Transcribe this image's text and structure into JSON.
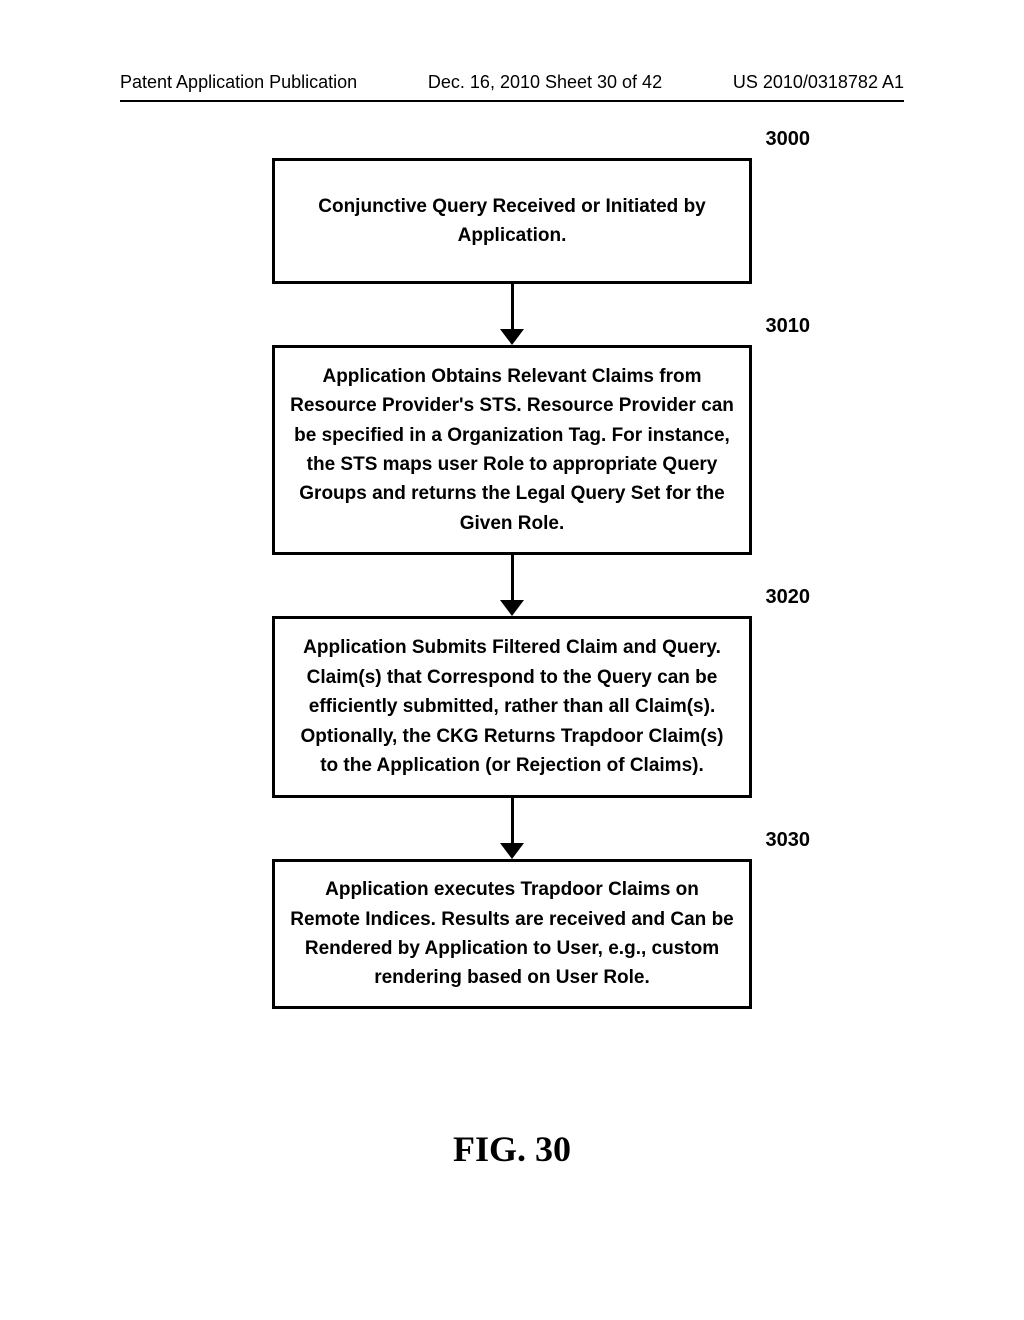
{
  "header": {
    "left": "Patent Application Publication",
    "center": "Dec. 16, 2010  Sheet 30 of 42",
    "right": "US 2010/0318782 A1"
  },
  "steps": [
    {
      "ref": "3000",
      "text": "Conjunctive Query Received or Initiated by Application."
    },
    {
      "ref": "3010",
      "text": "Application Obtains Relevant Claims from Resource Provider's STS. Resource Provider can be specified in a Organization Tag. For instance, the STS maps user Role to appropriate Query Groups and returns the Legal Query Set for the Given Role."
    },
    {
      "ref": "3020",
      "text": "Application Submits Filtered Claim and Query. Claim(s) that Correspond to the Query can be efficiently submitted, rather than all Claim(s). Optionally, the CKG Returns Trapdoor Claim(s) to the Application (or Rejection of Claims)."
    },
    {
      "ref": "3030",
      "text": "Application executes Trapdoor Claims on Remote Indices.  Results are received and Can be Rendered by Application to User, e.g., custom rendering based on User Role."
    }
  ],
  "figure_caption": "FIG. 30"
}
